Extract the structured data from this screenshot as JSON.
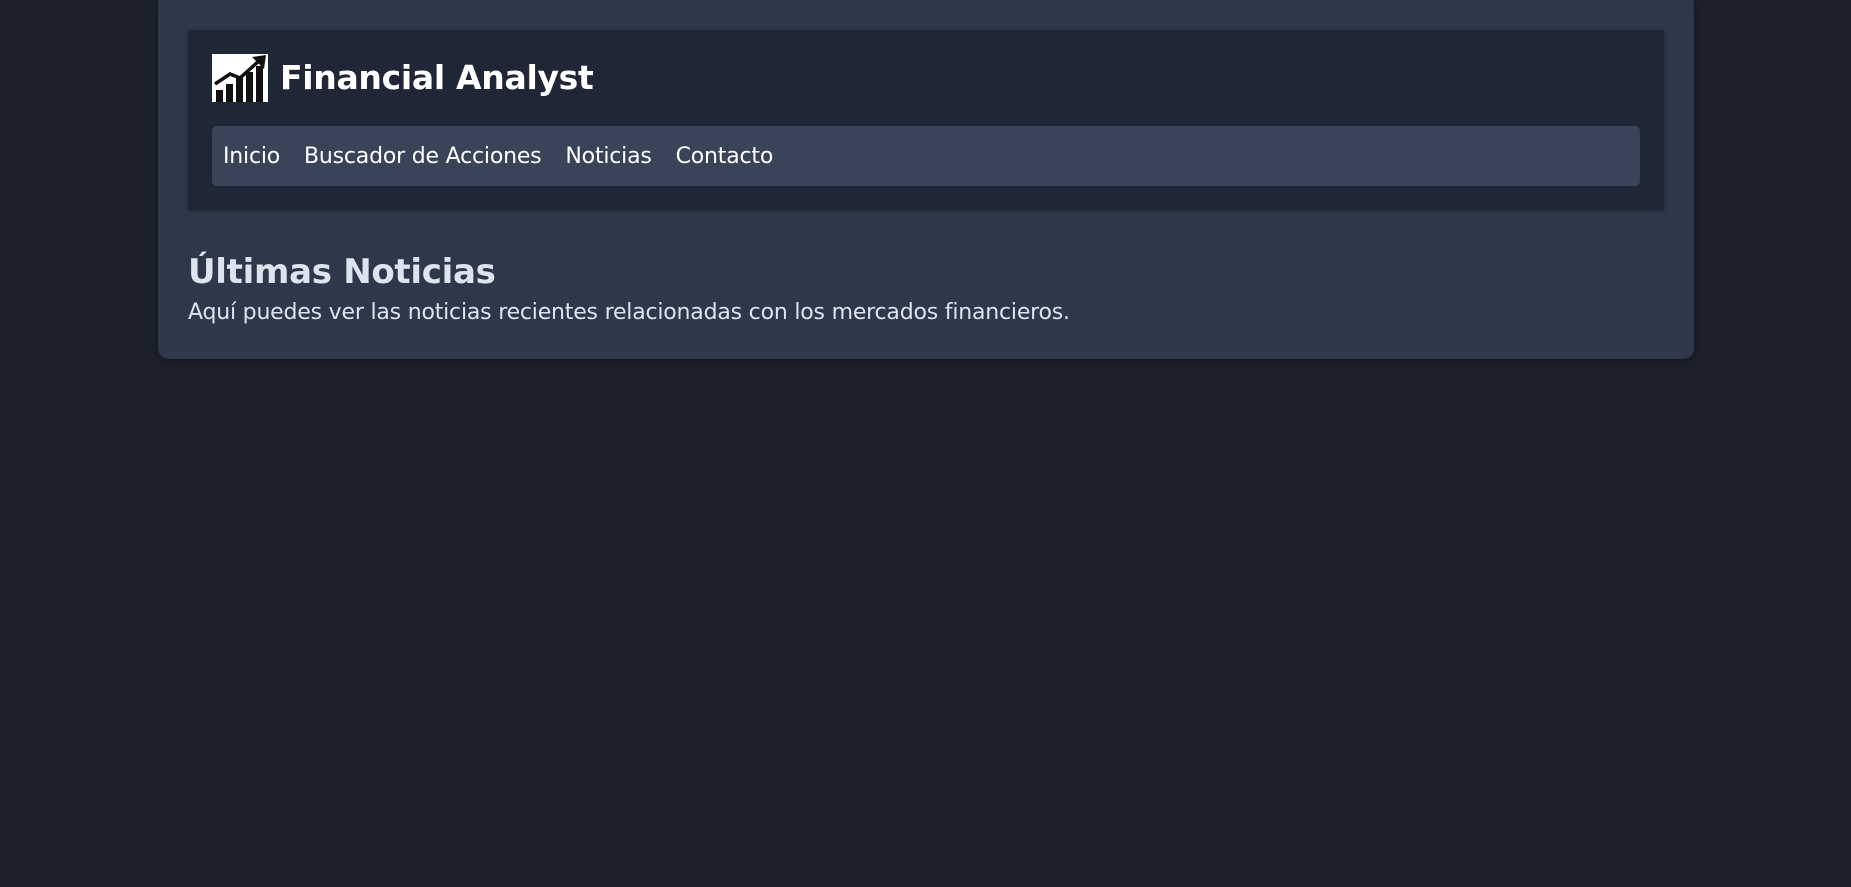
{
  "header": {
    "logo_icon": "chart-growth-icon",
    "title": "Financial Analyst"
  },
  "nav": {
    "items": [
      {
        "label": "Inicio"
      },
      {
        "label": "Buscador de Acciones"
      },
      {
        "label": "Noticias"
      },
      {
        "label": "Contacto"
      }
    ]
  },
  "main": {
    "heading": "Últimas Noticias",
    "description": "Aquí puedes ver las noticias recientes relacionadas con los mercados financieros."
  },
  "colors": {
    "page_background": "#1b202b",
    "card_background": "#2e384a",
    "header_background": "#1f2736",
    "nav_background": "#394458",
    "text": "#ffffff"
  }
}
